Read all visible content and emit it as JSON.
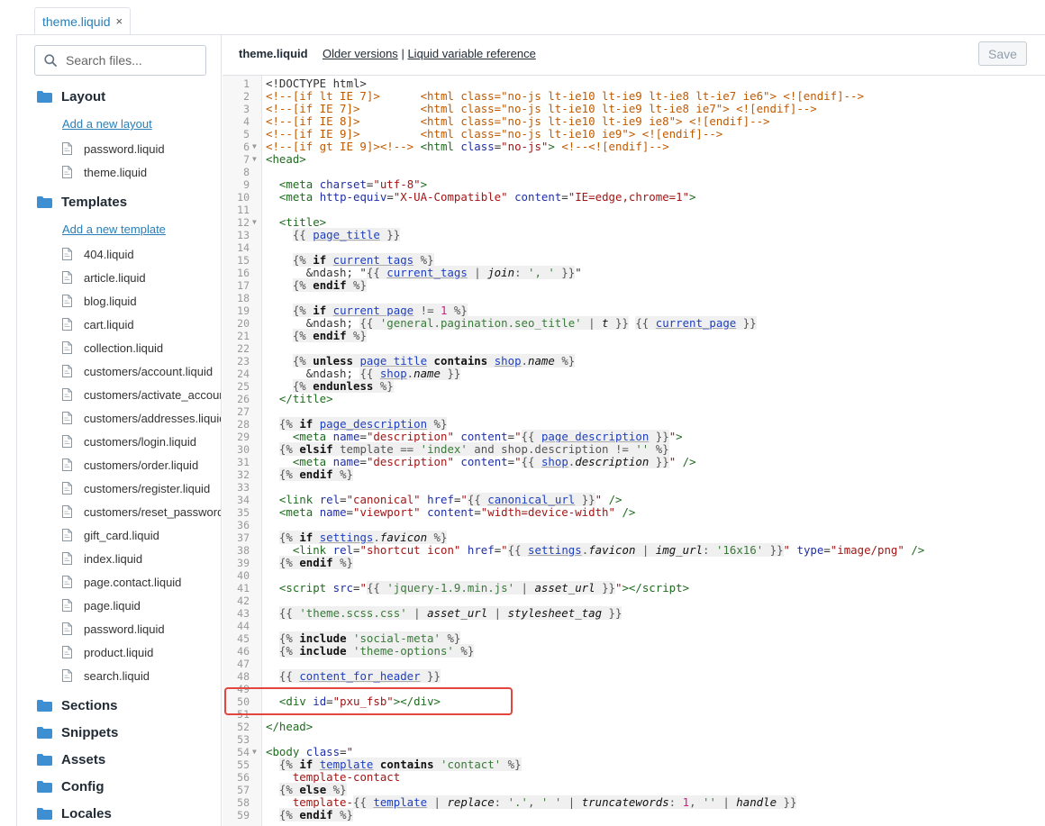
{
  "tab": {
    "label": "theme.liquid",
    "close": "×"
  },
  "sidebar": {
    "search_placeholder": "Search files...",
    "folders": [
      {
        "label": "Layout"
      },
      {
        "label": "Templates"
      },
      {
        "label": "Sections"
      },
      {
        "label": "Snippets"
      },
      {
        "label": "Assets"
      },
      {
        "label": "Config"
      },
      {
        "label": "Locales"
      }
    ],
    "layout": {
      "add_link": "Add a new layout",
      "files": [
        "password.liquid",
        "theme.liquid"
      ]
    },
    "templates": {
      "add_link": "Add a new template",
      "files": [
        "404.liquid",
        "article.liquid",
        "blog.liquid",
        "cart.liquid",
        "collection.liquid",
        "customers/account.liquid",
        "customers/activate_account.liquid",
        "customers/addresses.liquid",
        "customers/login.liquid",
        "customers/order.liquid",
        "customers/register.liquid",
        "customers/reset_password.liquid",
        "gift_card.liquid",
        "index.liquid",
        "page.contact.liquid",
        "page.liquid",
        "password.liquid",
        "product.liquid",
        "search.liquid"
      ]
    }
  },
  "editor": {
    "filename": "theme.liquid",
    "older_versions": "Older versions",
    "separator": "|",
    "liquid_ref": "Liquid variable reference",
    "save_label": "Save",
    "line_numbers": [
      "1",
      "2",
      "3",
      "4",
      "5",
      "6",
      "7",
      "8",
      "9",
      "10",
      "11",
      "12",
      "13",
      "14",
      "15",
      "16",
      "17",
      "18",
      "19",
      "20",
      "21",
      "22",
      "23",
      "24",
      "25",
      "26",
      "27",
      "28",
      "29",
      "30",
      "31",
      "32",
      "33",
      "34",
      "35",
      "36",
      "37",
      "38",
      "39",
      "40",
      "41",
      "42",
      "43",
      "44",
      "45",
      "46",
      "47",
      "48",
      "49",
      "50",
      "51",
      "52",
      "53",
      "54",
      "55",
      "56",
      "57",
      "58",
      "59"
    ],
    "folded_lines": [
      "6",
      "7",
      "12",
      "54"
    ]
  },
  "colors": {
    "link": "#2a7fb8",
    "highlight_box": "#e2463c",
    "folder_icon": "#3d8fd1"
  }
}
